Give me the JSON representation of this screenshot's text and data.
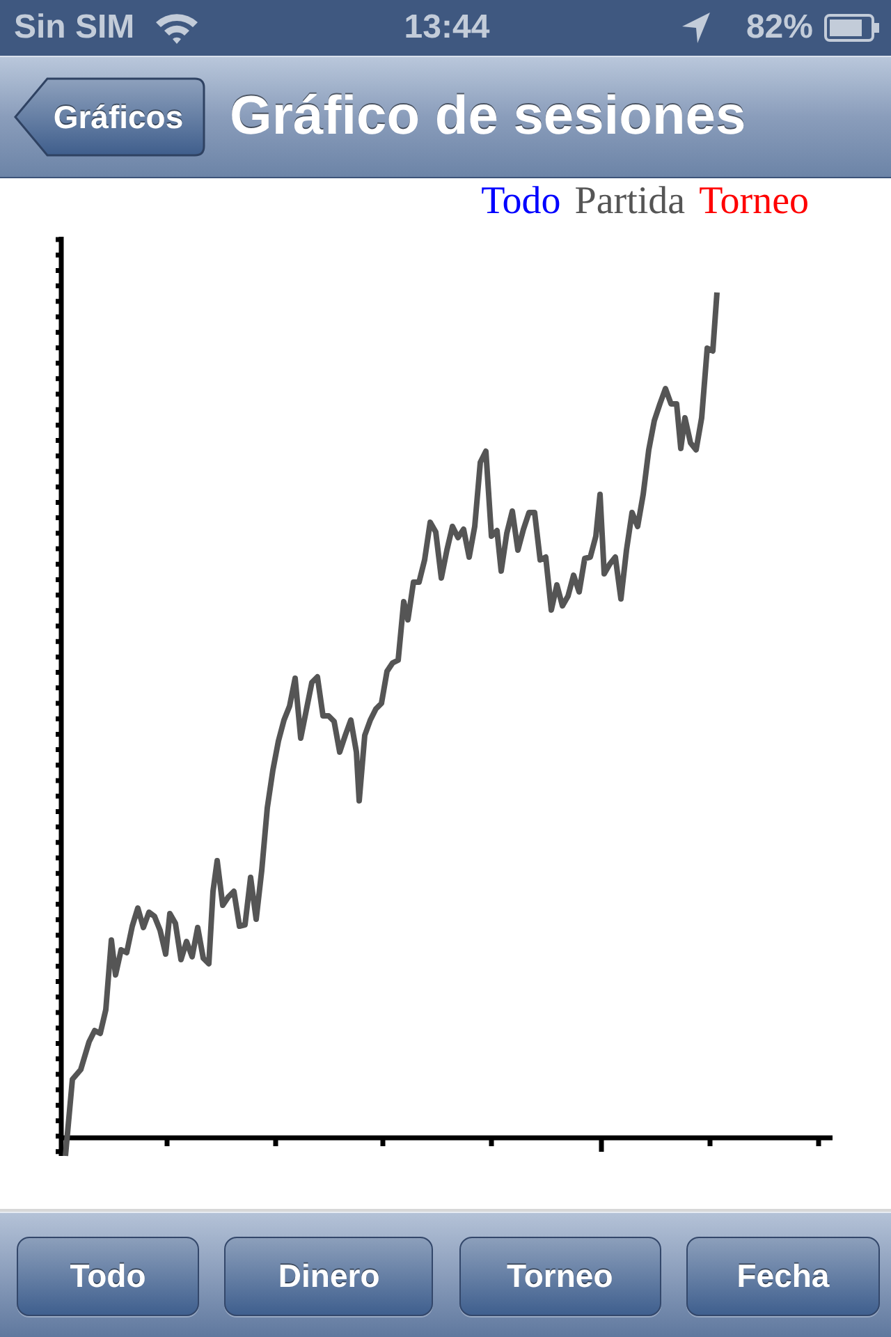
{
  "status_bar": {
    "carrier": "Sin SIM",
    "time": "13:44",
    "battery": "82%"
  },
  "nav_bar": {
    "back_button": "Gráficos",
    "title": "Gráfico de sesiones"
  },
  "chart": {
    "legend": [
      {
        "label": "Todo",
        "color": "#0000ff"
      },
      {
        "label": "Partida",
        "color": "#555555"
      },
      {
        "label": "Torneo",
        "color": "#ff0000"
      }
    ]
  },
  "toolbar": {
    "buttons": [
      "Todo",
      "Dinero",
      "Torneo",
      "Fecha"
    ]
  }
}
